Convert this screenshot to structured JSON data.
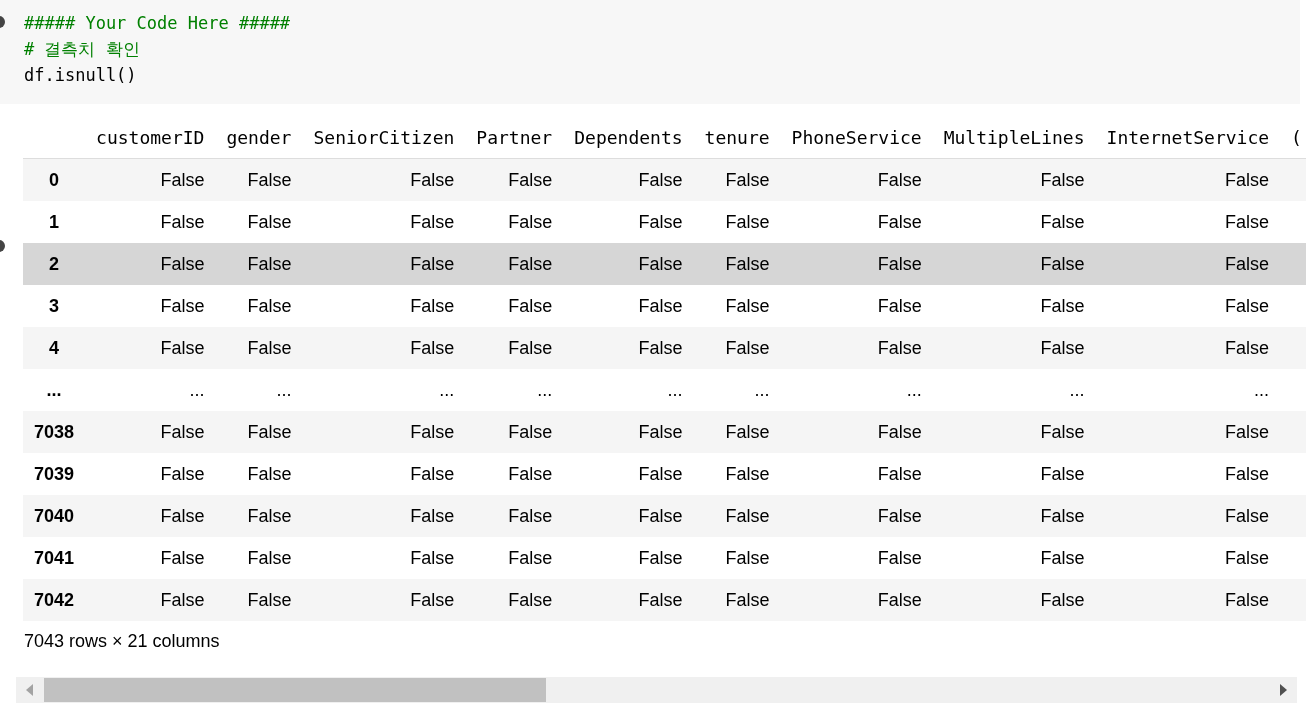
{
  "code_cell": {
    "lines": [
      {
        "kind": "comment",
        "text": "##### Your Code Here #####"
      },
      {
        "kind": "comment",
        "text": "# 결측치 확인"
      },
      {
        "kind": "code",
        "text": "df.isnull()"
      }
    ]
  },
  "output": {
    "columns": [
      "customerID",
      "gender",
      "SeniorCitizen",
      "Partner",
      "Dependents",
      "tenure",
      "PhoneService",
      "MultipleLines",
      "InternetService",
      "("
    ],
    "rows": [
      {
        "index": "0",
        "highlighted": false,
        "cells": [
          "False",
          "False",
          "False",
          "False",
          "False",
          "False",
          "False",
          "False",
          "False"
        ]
      },
      {
        "index": "1",
        "highlighted": false,
        "cells": [
          "False",
          "False",
          "False",
          "False",
          "False",
          "False",
          "False",
          "False",
          "False"
        ]
      },
      {
        "index": "2",
        "highlighted": true,
        "cells": [
          "False",
          "False",
          "False",
          "False",
          "False",
          "False",
          "False",
          "False",
          "False"
        ]
      },
      {
        "index": "3",
        "highlighted": false,
        "cells": [
          "False",
          "False",
          "False",
          "False",
          "False",
          "False",
          "False",
          "False",
          "False"
        ]
      },
      {
        "index": "4",
        "highlighted": false,
        "cells": [
          "False",
          "False",
          "False",
          "False",
          "False",
          "False",
          "False",
          "False",
          "False"
        ]
      },
      {
        "index": "...",
        "highlighted": false,
        "cells": [
          "...",
          "...",
          "...",
          "...",
          "...",
          "...",
          "...",
          "...",
          "..."
        ]
      },
      {
        "index": "7038",
        "highlighted": false,
        "cells": [
          "False",
          "False",
          "False",
          "False",
          "False",
          "False",
          "False",
          "False",
          "False"
        ]
      },
      {
        "index": "7039",
        "highlighted": false,
        "cells": [
          "False",
          "False",
          "False",
          "False",
          "False",
          "False",
          "False",
          "False",
          "False"
        ]
      },
      {
        "index": "7040",
        "highlighted": false,
        "cells": [
          "False",
          "False",
          "False",
          "False",
          "False",
          "False",
          "False",
          "False",
          "False"
        ]
      },
      {
        "index": "7041",
        "highlighted": false,
        "cells": [
          "False",
          "False",
          "False",
          "False",
          "False",
          "False",
          "False",
          "False",
          "False"
        ]
      },
      {
        "index": "7042",
        "highlighted": false,
        "cells": [
          "False",
          "False",
          "False",
          "False",
          "False",
          "False",
          "False",
          "False",
          "False"
        ]
      }
    ],
    "summary": "7043 rows × 21 columns"
  }
}
